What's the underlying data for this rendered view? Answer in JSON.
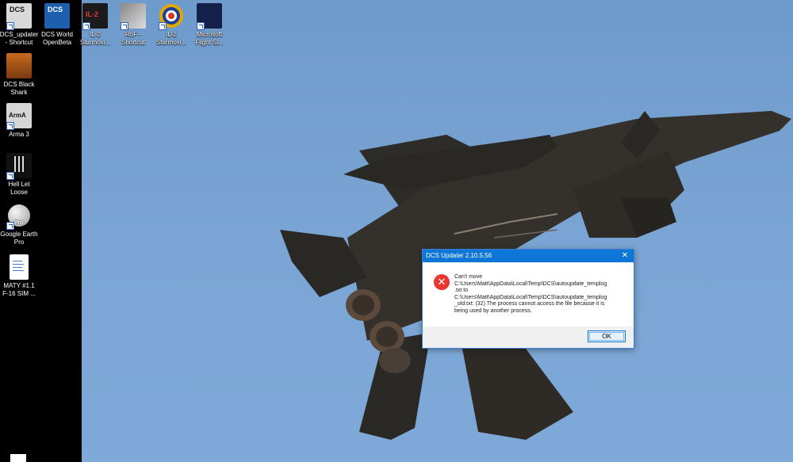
{
  "desktop": {
    "icons": [
      {
        "label": "DCS_updater\n- Shortcut",
        "icon": "dcs-updater-icon"
      },
      {
        "label": "DCS World\nOpenBeta",
        "icon": "dcs-world-icon"
      },
      {
        "label": "IL-2\nSturmovi...",
        "icon": "il2-icon"
      },
      {
        "label": "RoF -\nShortcut",
        "icon": "rof-icon"
      },
      {
        "label": "IL-2\nSturmovi...",
        "icon": "il2-roundel-icon"
      },
      {
        "label": "Microsoft\nFlight Si...",
        "icon": "flight-simulator-icon"
      },
      {
        "label": "DCS Black\nShark",
        "icon": "dcs-black-shark-icon"
      },
      {
        "label": "Arma 3",
        "icon": "arma3-icon"
      },
      {
        "label": "Hell Let\nLoose",
        "icon": "hell-let-loose-icon"
      },
      {
        "label": "Google Earth\nPro",
        "icon": "google-earth-icon"
      },
      {
        "label": "MATY #1.1\nF-16 SIM ...",
        "icon": "document-icon"
      }
    ],
    "icon_badges": {
      "il2": "IL-2",
      "arma": "ArmA",
      "pro": "Pro",
      "dcs": "DCS"
    }
  },
  "dialog": {
    "title": "DCS Updater 2.10.5.56",
    "close_glyph": "✕",
    "error_glyph": "✕",
    "message_lines": [
      "Can't move",
      "C:\\Users\\Matt\\AppData\\Local\\Temp\\DCS\\autoupdate_templog",
      ".txt to",
      "C:\\Users\\Matt\\AppData\\Local\\Temp\\DCS\\autoupdate_templog",
      "_old.txt: (32) The process cannot access the file because it is",
      "being used by another process."
    ],
    "ok_label": "OK"
  },
  "colors": {
    "titlebar": "#0e76d6",
    "error": "#e8372e",
    "sky": "#7aa5d4"
  }
}
